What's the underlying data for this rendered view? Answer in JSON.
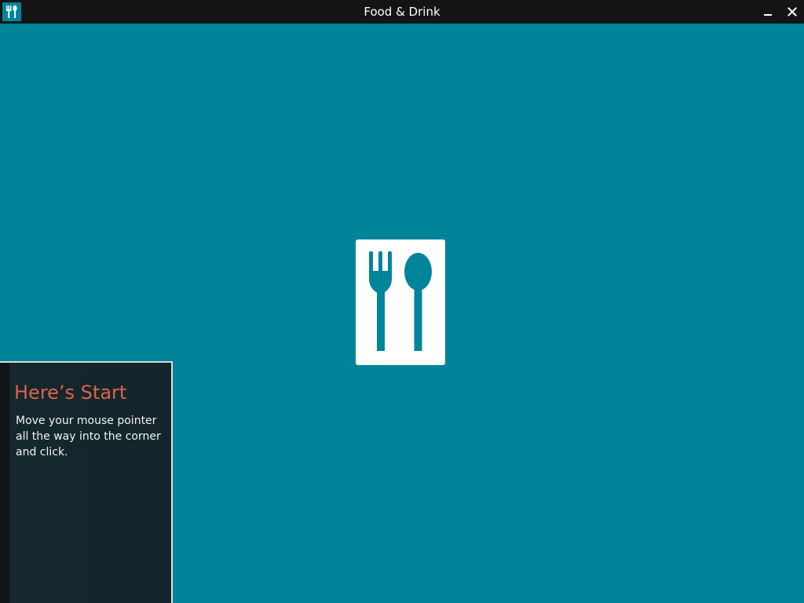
{
  "window": {
    "title": "Food & Drink",
    "app_icon": "fork-spoon-icon",
    "controls": {
      "minimize_icon": "minimize-icon",
      "close_icon": "close-icon"
    }
  },
  "splash": {
    "icon": "fork-spoon-icon"
  },
  "start_tip": {
    "title": "Here’s Start",
    "body": "Move your mouse pointer all the way into the corner and click."
  },
  "colors": {
    "background": "#008499",
    "titlebar": "#141414",
    "tip_background": "#14262c",
    "tip_title": "#d9644f",
    "tile": "#ffffff"
  }
}
